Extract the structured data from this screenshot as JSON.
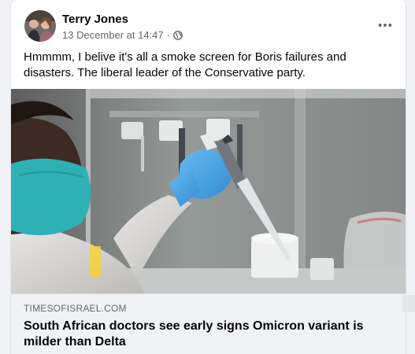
{
  "post": {
    "author": "Terry Jones",
    "timestamp": "13 December at 14:47",
    "separator": "·",
    "audience_icon": "globe-icon",
    "more_icon": "more-horizontal-icon",
    "text": "Hmmmm, I belive it's all a smoke screen for Boris failures and disasters. The liberal leader of the Conservative party."
  },
  "link_preview": {
    "domain": "TIMESOFISRAEL.COM",
    "title": "South African doctors see early signs Omicron variant is milder than Delta"
  },
  "colors": {
    "page_bg": "#f0f2f5",
    "card_bg": "#ffffff",
    "primary_text": "#050505",
    "secondary_text": "#65676b",
    "glove_blue": "#3aa0e8",
    "mask_teal": "#39b3b7"
  }
}
